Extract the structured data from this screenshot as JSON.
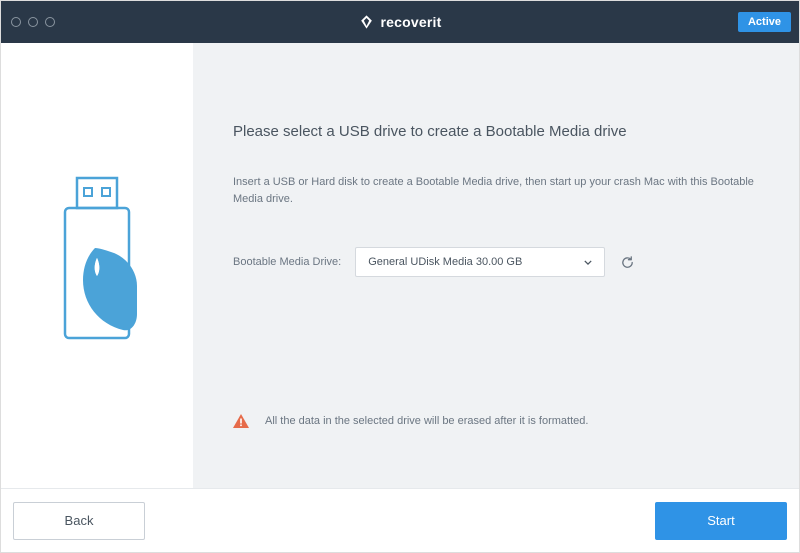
{
  "header": {
    "brand_name": "recoverit",
    "active_badge": "Active"
  },
  "main": {
    "heading": "Please select a USB drive to create a Bootable Media drive",
    "instruction": "Insert a USB or Hard disk to create a Bootable Media drive, then start up your crash Mac with this Bootable Media drive.",
    "field_label": "Bootable Media Drive:",
    "dropdown_selected": "General UDisk Media 30.00 GB",
    "warning_text": "All the data in the selected drive will be erased after it is formatted."
  },
  "footer": {
    "back_label": "Back",
    "start_label": "Start"
  },
  "colors": {
    "accent": "#2f93e6",
    "titlebar": "#2a3848",
    "warning": "#e66b4a"
  }
}
